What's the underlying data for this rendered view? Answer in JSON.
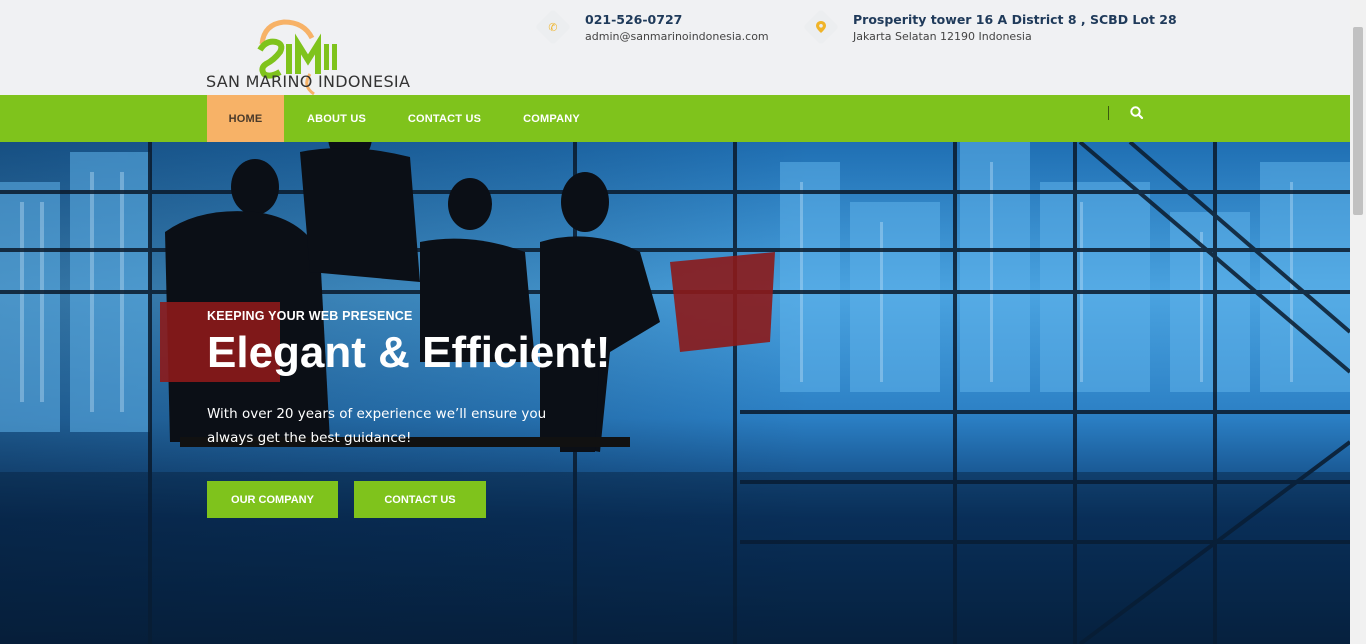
{
  "brand": {
    "logo_text": "SAN MARINO INDONESIA",
    "logo_colors": {
      "green": "#7fc31c",
      "orange": "#f7b267"
    }
  },
  "contact": {
    "phone": "021-526-0727",
    "email": "admin@sanmarinoindonesia.com",
    "address_line1": "Prosperity tower 16 A District 8 , SCBD Lot 28",
    "address_line2": "Jakarta Selatan 12190 Indonesia",
    "phone_icon": "phone-icon",
    "location_icon": "map-pin-icon"
  },
  "nav": {
    "items": [
      {
        "label": "HOME",
        "active": true
      },
      {
        "label": "ABOUT US",
        "active": false
      },
      {
        "label": "CONTACT US",
        "active": false
      },
      {
        "label": "COMPANY",
        "active": false
      }
    ],
    "search_icon": "search-icon"
  },
  "hero": {
    "kicker": "KEEPING YOUR WEB PRESENCE",
    "title": "Elegant & Efficient!",
    "description": "With over 20 years of experience we’ll ensure you always get the best guidance!",
    "buttons": {
      "company": "OUR COMPANY",
      "contact": "CONTACT US"
    }
  },
  "colors": {
    "accent": "#7fc31c",
    "active_nav": "#f7b267",
    "header_bg": "#f0f1f3",
    "contact_text": "#1f3a5a"
  }
}
